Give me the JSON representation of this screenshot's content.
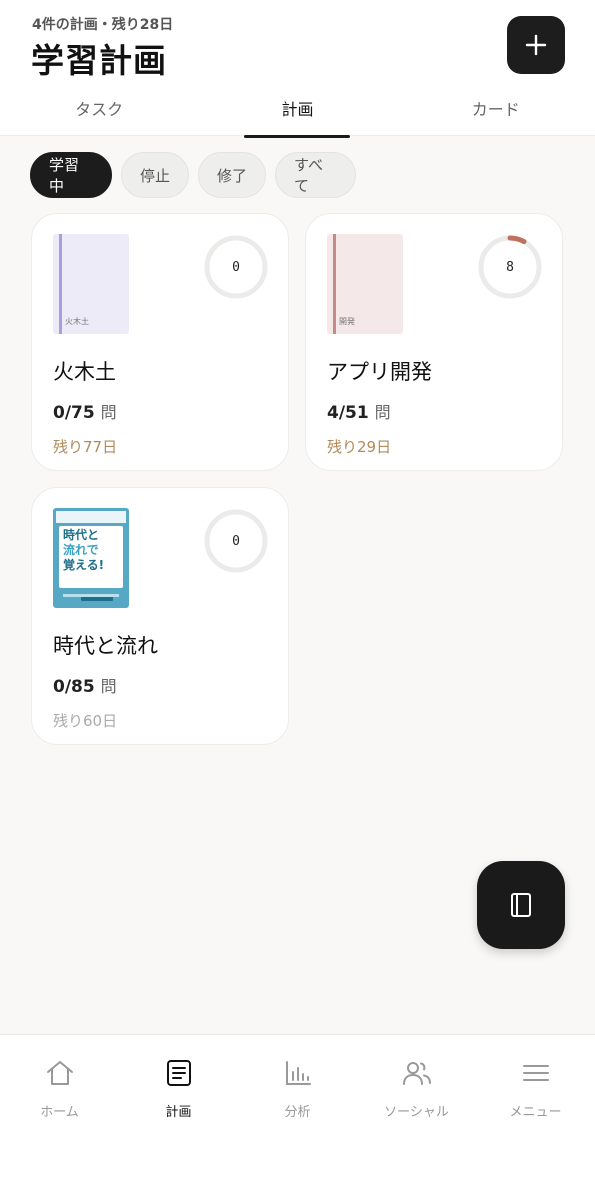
{
  "header": {
    "subtitle": "4件の計画・残り28日",
    "title": "学習計画",
    "add_icon": "plus-icon"
  },
  "tabs": [
    {
      "label": "タスク",
      "active": false
    },
    {
      "label": "計画",
      "active": true
    },
    {
      "label": "カード",
      "active": false
    }
  ],
  "filters": [
    {
      "label": "学習中",
      "active": true
    },
    {
      "label": "停止",
      "active": false
    },
    {
      "label": "修了",
      "active": false
    },
    {
      "label": "すべて",
      "active": false
    }
  ],
  "plans": [
    {
      "cover_text": "火木土",
      "cover_color": "#ecebf7",
      "spine_color": "#a89ee0",
      "progress_number": "0",
      "progress_fraction": 0,
      "title": "火木土",
      "progress": "0/75",
      "unit": "問",
      "remaining": "残り77日"
    },
    {
      "cover_text": "開発",
      "cover_color": "#f5e8e8",
      "spine_color": "#c58a85",
      "progress_number": "8",
      "progress_fraction": 0.08,
      "title": "アプリ開発",
      "progress": "4/51",
      "unit": "問",
      "remaining": "残り29日"
    },
    {
      "cover_lines": [
        "時代と",
        "流れで",
        "覚える!"
      ],
      "progress_number": "0",
      "progress_fraction": 0,
      "title": "時代と流れ",
      "progress": "0/85",
      "unit": "問",
      "remaining": "残り60日"
    }
  ],
  "fab_icon": "book-icon",
  "bottom_nav": [
    {
      "label": "ホーム",
      "icon": "home-icon",
      "active": false
    },
    {
      "label": "計画",
      "icon": "plan-icon",
      "active": true
    },
    {
      "label": "分析",
      "icon": "chart-icon",
      "active": false
    },
    {
      "label": "ソーシャル",
      "icon": "people-icon",
      "active": false
    },
    {
      "label": "メニュー",
      "icon": "menu-icon",
      "active": false
    }
  ],
  "colors": {
    "accent": "#1a1a1a",
    "remaining_warm": "#b08a5a",
    "remaining_muted": "#aaaaaa",
    "ring_track": "#ebebea",
    "ring_progress": "#c0705f"
  }
}
